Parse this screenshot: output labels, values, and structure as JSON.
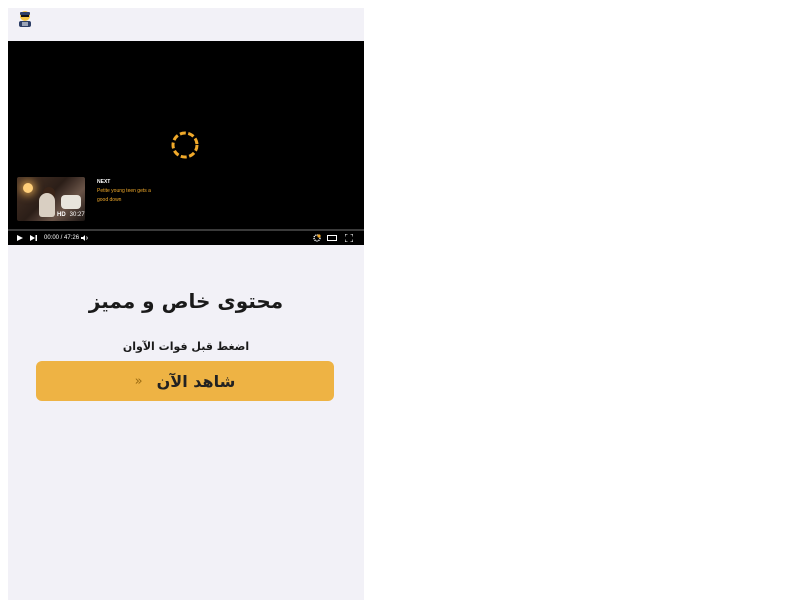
{
  "header": {
    "logo_icon": "hacker-icon"
  },
  "player": {
    "next_label": "NEXT",
    "next_title": "Petite young teen gets a good down",
    "quality_badge": "HD",
    "next_duration": "30:27",
    "time_display": "00:00 / 47:26",
    "progress": 0,
    "spinner_color": "#f0a92a"
  },
  "promo": {
    "headline": "محتوى خاص و مميز",
    "subline": "اضغط قبل فوات الآوان",
    "cta_label": "شاهد الآن",
    "cta_arrows": "»",
    "cta_color": "#eeb344"
  }
}
